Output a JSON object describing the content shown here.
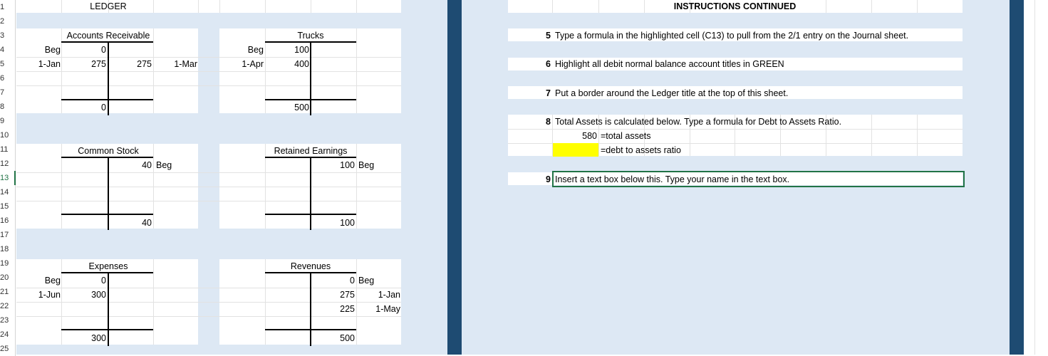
{
  "row_headers": [
    "1",
    "2",
    "3",
    "4",
    "5",
    "6",
    "7",
    "8",
    "9",
    "10",
    "11",
    "12",
    "13",
    "14",
    "15",
    "16",
    "17",
    "18",
    "19",
    "20",
    "21",
    "22",
    "23",
    "24",
    "25"
  ],
  "selected_row": "13",
  "ledger": {
    "title": "LEDGER",
    "accounts_receivable": {
      "title": "Accounts Receivable",
      "rows": [
        {
          "label": "Beg",
          "debit": "0",
          "credit": "",
          "date": ""
        },
        {
          "label": "1-Jan",
          "debit": "275",
          "credit": "275",
          "date": "1-Mar"
        }
      ],
      "balance": "0"
    },
    "trucks": {
      "title": "Trucks",
      "rows": [
        {
          "label": "Beg",
          "debit": "100"
        },
        {
          "label": "1-Apr",
          "debit": "400"
        }
      ],
      "balance": "500"
    },
    "common_stock": {
      "title": "Common Stock",
      "credit": "40",
      "credit_label": "Beg",
      "balance": "40"
    },
    "retained_earnings": {
      "title": "Retained Earnings",
      "credit": "100",
      "credit_label": "Beg",
      "balance": "100"
    },
    "expenses": {
      "title": "Expenses",
      "rows": [
        {
          "label": "Beg",
          "debit": "0"
        },
        {
          "label": "1-Jun",
          "debit": "300"
        }
      ],
      "balance": "300"
    },
    "revenues": {
      "title": "Revenues",
      "rows": [
        {
          "credit": "0",
          "label": "Beg"
        },
        {
          "credit": "275",
          "label": "1-Jan"
        },
        {
          "credit": "225",
          "label": "1-May"
        }
      ],
      "balance": "500"
    }
  },
  "instructions": {
    "title": "INSTRUCTIONS CONTINUED",
    "items": [
      {
        "num": "5",
        "text": "Type a formula in the highlighted cell (C13) to pull from the 2/1 entry on the Journal sheet."
      },
      {
        "num": "6",
        "text": "Highlight all debit normal balance account titles  in GREEN"
      },
      {
        "num": "7",
        "text": "Put a border around the Ledger title at the top of this sheet."
      },
      {
        "num": "8",
        "text": "Total Assets is calculated below. Type a formula for Debt to Assets Ratio."
      },
      {
        "num": "9",
        "text": "Insert a text box below this. Type your name in the text box."
      }
    ],
    "total_assets_value": "580",
    "total_assets_label": "=total assets",
    "ratio_label": "=debt to assets ratio"
  },
  "colors": {
    "band": "#dde8f4",
    "navy": "#1e4b72",
    "highlight": "#ffff00",
    "selection": "#217346"
  }
}
